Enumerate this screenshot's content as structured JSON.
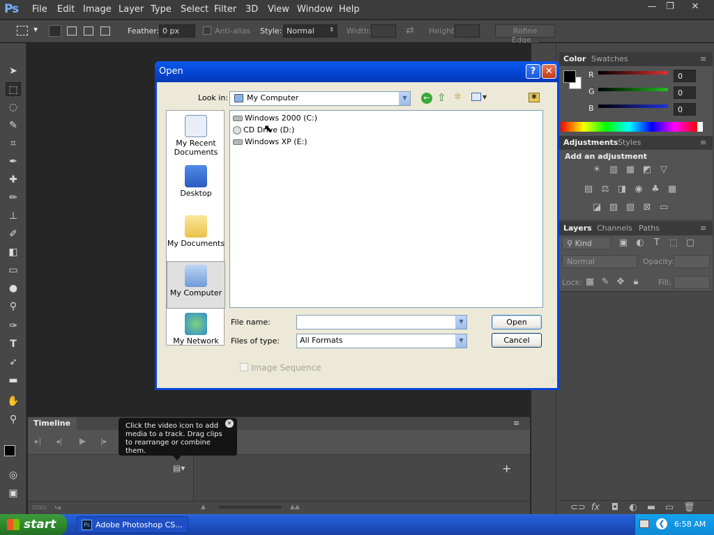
{
  "app": {
    "logo": "Ps"
  },
  "menu": [
    "File",
    "Edit",
    "Image",
    "Layer",
    "Type",
    "Select",
    "Filter",
    "3D",
    "View",
    "Window",
    "Help"
  ],
  "window_controls": {
    "minimize": "—",
    "restore": "❐",
    "close": "✕"
  },
  "options_bar": {
    "feather_label": "Feather:",
    "feather_value": "0 px",
    "antialias_label": "Anti-alias",
    "style_label": "Style:",
    "style_value": "Normal",
    "width_label": "Width:",
    "height_label": "Height:",
    "refine_edge": "Refine Edge..."
  },
  "panels": {
    "color_tabs": [
      "Color",
      "Swatches"
    ],
    "color_sliders": [
      {
        "label": "R",
        "value": "0",
        "color": "#e03030"
      },
      {
        "label": "G",
        "value": "0",
        "color": "#20c020"
      },
      {
        "label": "B",
        "value": "0",
        "color": "#2030e0"
      }
    ],
    "adjust_tabs": [
      "Adjustments",
      "Styles"
    ],
    "add_adjustment": "Add an adjustment",
    "layers_tabs": [
      "Layers",
      "Channels",
      "Paths"
    ],
    "layers_kind": "Kind",
    "blend_mode": "Normal",
    "opacity_label": "Opacity:",
    "lock_label": "Lock:",
    "fill_label": "Fill:"
  },
  "timeline": {
    "title": "Timeline",
    "tooltip": "Click the video icon to add media to a track. Drag clips to rearrange or combine them."
  },
  "dialog": {
    "title": "Open",
    "help": "?",
    "close": "✕",
    "look_in_label": "Look in:",
    "look_in_value": "My Computer",
    "places": [
      "My Recent Documents",
      "Desktop",
      "My Documents",
      "My Computer",
      "My Network"
    ],
    "drives": [
      "Windows 2000 (C:)",
      "CD Drive (D:)",
      "Windows XP (E:)"
    ],
    "file_name_label": "File name:",
    "file_name_value": "",
    "files_of_type_label": "Files of type:",
    "files_of_type_value": "All Formats",
    "open_btn": "Open",
    "cancel_btn": "Cancel",
    "image_sequence": "Image Sequence"
  },
  "taskbar": {
    "start": "start",
    "task": "Adobe Photoshop CS...",
    "clock": "6:58 AM"
  }
}
